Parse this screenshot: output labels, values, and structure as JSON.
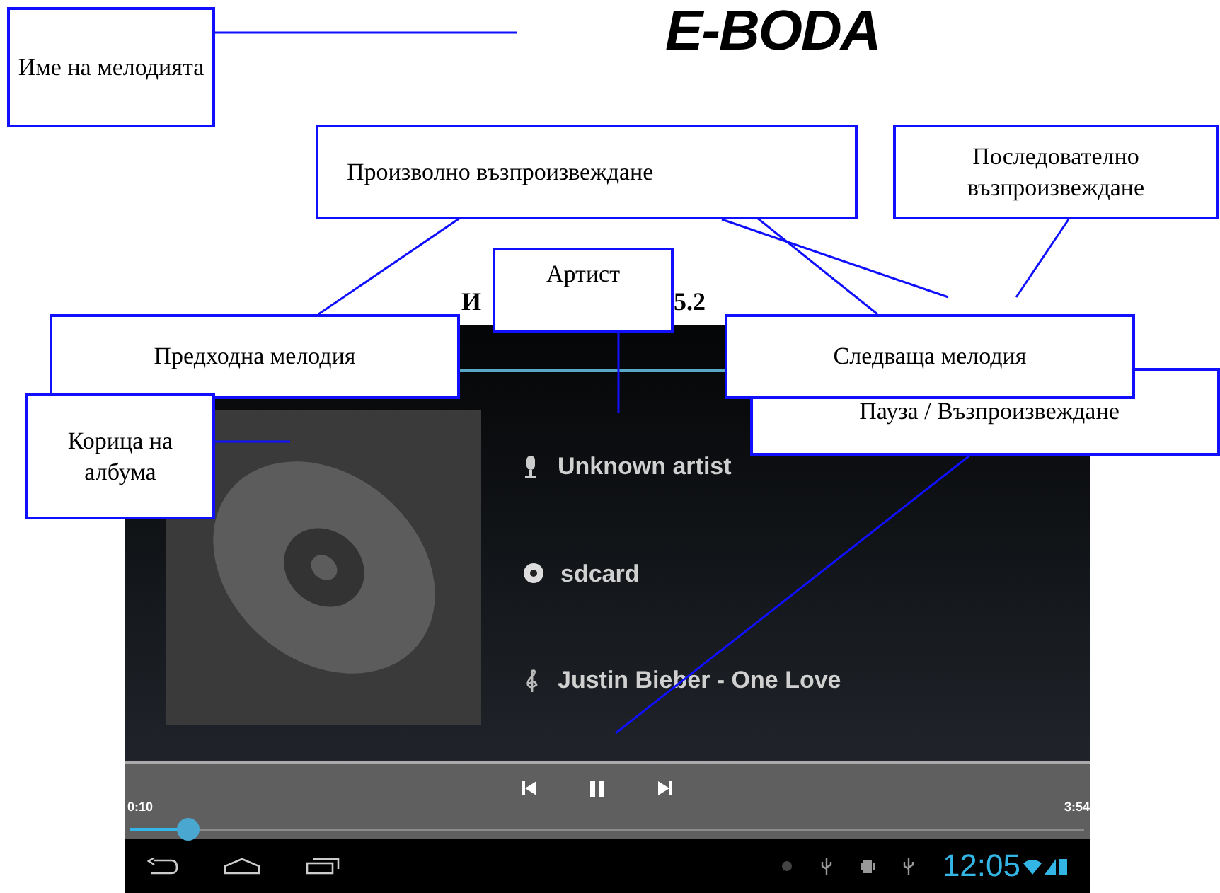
{
  "logo": {
    "text": "E-BODA"
  },
  "figure_caption": {
    "visible_start": "И",
    "visible_end": "5.2"
  },
  "player": {
    "artist": "Unknown artist",
    "storage": "sdcard",
    "song": "Justin Bieber - One Love",
    "elapsed": "0:10",
    "duration": "3:54",
    "playing": true,
    "level": 0.05,
    "clock": "12:05"
  },
  "callouts": [
    {
      "text": "Име на мелодията"
    },
    {
      "text": "Произволно възпроизвеждане"
    },
    {
      "text": "Последователно възпроизвеждане"
    },
    {
      "text": "Артист"
    },
    {
      "text": "Предходна мелодия"
    },
    {
      "text": "Следваща мелодия"
    },
    {
      "text": "Пауза / Възпроизвеждане"
    },
    {
      "text": "Корица на албума"
    }
  ]
}
